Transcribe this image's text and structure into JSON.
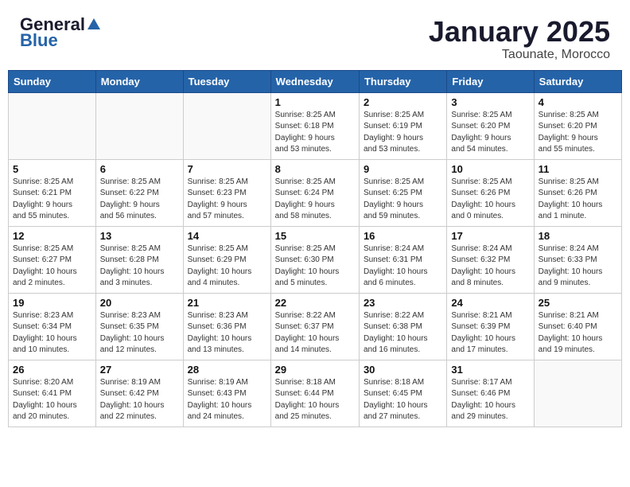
{
  "header": {
    "logo_general": "General",
    "logo_blue": "Blue",
    "title": "January 2025",
    "subtitle": "Taounate, Morocco"
  },
  "weekdays": [
    "Sunday",
    "Monday",
    "Tuesday",
    "Wednesday",
    "Thursday",
    "Friday",
    "Saturday"
  ],
  "weeks": [
    [
      {
        "day": "",
        "info": ""
      },
      {
        "day": "",
        "info": ""
      },
      {
        "day": "",
        "info": ""
      },
      {
        "day": "1",
        "info": "Sunrise: 8:25 AM\nSunset: 6:18 PM\nDaylight: 9 hours\nand 53 minutes."
      },
      {
        "day": "2",
        "info": "Sunrise: 8:25 AM\nSunset: 6:19 PM\nDaylight: 9 hours\nand 53 minutes."
      },
      {
        "day": "3",
        "info": "Sunrise: 8:25 AM\nSunset: 6:20 PM\nDaylight: 9 hours\nand 54 minutes."
      },
      {
        "day": "4",
        "info": "Sunrise: 8:25 AM\nSunset: 6:20 PM\nDaylight: 9 hours\nand 55 minutes."
      }
    ],
    [
      {
        "day": "5",
        "info": "Sunrise: 8:25 AM\nSunset: 6:21 PM\nDaylight: 9 hours\nand 55 minutes."
      },
      {
        "day": "6",
        "info": "Sunrise: 8:25 AM\nSunset: 6:22 PM\nDaylight: 9 hours\nand 56 minutes."
      },
      {
        "day": "7",
        "info": "Sunrise: 8:25 AM\nSunset: 6:23 PM\nDaylight: 9 hours\nand 57 minutes."
      },
      {
        "day": "8",
        "info": "Sunrise: 8:25 AM\nSunset: 6:24 PM\nDaylight: 9 hours\nand 58 minutes."
      },
      {
        "day": "9",
        "info": "Sunrise: 8:25 AM\nSunset: 6:25 PM\nDaylight: 9 hours\nand 59 minutes."
      },
      {
        "day": "10",
        "info": "Sunrise: 8:25 AM\nSunset: 6:26 PM\nDaylight: 10 hours\nand 0 minutes."
      },
      {
        "day": "11",
        "info": "Sunrise: 8:25 AM\nSunset: 6:26 PM\nDaylight: 10 hours\nand 1 minute."
      }
    ],
    [
      {
        "day": "12",
        "info": "Sunrise: 8:25 AM\nSunset: 6:27 PM\nDaylight: 10 hours\nand 2 minutes."
      },
      {
        "day": "13",
        "info": "Sunrise: 8:25 AM\nSunset: 6:28 PM\nDaylight: 10 hours\nand 3 minutes."
      },
      {
        "day": "14",
        "info": "Sunrise: 8:25 AM\nSunset: 6:29 PM\nDaylight: 10 hours\nand 4 minutes."
      },
      {
        "day": "15",
        "info": "Sunrise: 8:25 AM\nSunset: 6:30 PM\nDaylight: 10 hours\nand 5 minutes."
      },
      {
        "day": "16",
        "info": "Sunrise: 8:24 AM\nSunset: 6:31 PM\nDaylight: 10 hours\nand 6 minutes."
      },
      {
        "day": "17",
        "info": "Sunrise: 8:24 AM\nSunset: 6:32 PM\nDaylight: 10 hours\nand 8 minutes."
      },
      {
        "day": "18",
        "info": "Sunrise: 8:24 AM\nSunset: 6:33 PM\nDaylight: 10 hours\nand 9 minutes."
      }
    ],
    [
      {
        "day": "19",
        "info": "Sunrise: 8:23 AM\nSunset: 6:34 PM\nDaylight: 10 hours\nand 10 minutes."
      },
      {
        "day": "20",
        "info": "Sunrise: 8:23 AM\nSunset: 6:35 PM\nDaylight: 10 hours\nand 12 minutes."
      },
      {
        "day": "21",
        "info": "Sunrise: 8:23 AM\nSunset: 6:36 PM\nDaylight: 10 hours\nand 13 minutes."
      },
      {
        "day": "22",
        "info": "Sunrise: 8:22 AM\nSunset: 6:37 PM\nDaylight: 10 hours\nand 14 minutes."
      },
      {
        "day": "23",
        "info": "Sunrise: 8:22 AM\nSunset: 6:38 PM\nDaylight: 10 hours\nand 16 minutes."
      },
      {
        "day": "24",
        "info": "Sunrise: 8:21 AM\nSunset: 6:39 PM\nDaylight: 10 hours\nand 17 minutes."
      },
      {
        "day": "25",
        "info": "Sunrise: 8:21 AM\nSunset: 6:40 PM\nDaylight: 10 hours\nand 19 minutes."
      }
    ],
    [
      {
        "day": "26",
        "info": "Sunrise: 8:20 AM\nSunset: 6:41 PM\nDaylight: 10 hours\nand 20 minutes."
      },
      {
        "day": "27",
        "info": "Sunrise: 8:19 AM\nSunset: 6:42 PM\nDaylight: 10 hours\nand 22 minutes."
      },
      {
        "day": "28",
        "info": "Sunrise: 8:19 AM\nSunset: 6:43 PM\nDaylight: 10 hours\nand 24 minutes."
      },
      {
        "day": "29",
        "info": "Sunrise: 8:18 AM\nSunset: 6:44 PM\nDaylight: 10 hours\nand 25 minutes."
      },
      {
        "day": "30",
        "info": "Sunrise: 8:18 AM\nSunset: 6:45 PM\nDaylight: 10 hours\nand 27 minutes."
      },
      {
        "day": "31",
        "info": "Sunrise: 8:17 AM\nSunset: 6:46 PM\nDaylight: 10 hours\nand 29 minutes."
      },
      {
        "day": "",
        "info": ""
      }
    ]
  ]
}
